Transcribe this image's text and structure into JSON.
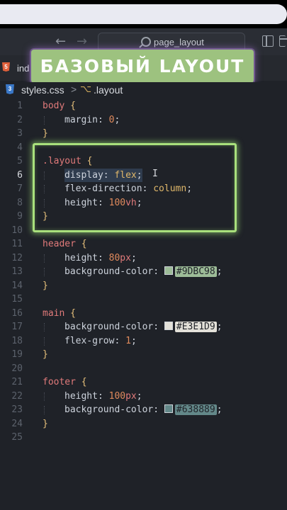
{
  "window": {
    "search_text": "page_layout",
    "back_icon": "arrow-left-icon",
    "forward_icon": "arrow-right-icon"
  },
  "tab": {
    "label": "ind"
  },
  "banner": {
    "text": "БАЗОВЫЙ LAYOUT"
  },
  "breadcrumb": {
    "file": "styles.css",
    "separator": ">",
    "symbol": ".layout"
  },
  "colors": {
    "header_bg": "#9DBC98",
    "main_bg": "#E3E1D9",
    "footer_bg": "#638889",
    "highlight_green": "#a9e07c"
  },
  "code_lines": [
    {
      "n": "1",
      "t": "body {"
    },
    {
      "n": "2",
      "p": "margin",
      "v": "0"
    },
    {
      "n": "3",
      "t": "}"
    },
    {
      "n": "4",
      "t": ""
    },
    {
      "n": "5",
      "t": ".layout {"
    },
    {
      "n": "6",
      "p": "display",
      "v": "flex"
    },
    {
      "n": "7",
      "p": "flex-direction",
      "v": "column"
    },
    {
      "n": "8",
      "p": "height",
      "v": "100vh"
    },
    {
      "n": "9",
      "t": "}"
    },
    {
      "n": "10",
      "t": ""
    },
    {
      "n": "11",
      "t": "header {"
    },
    {
      "n": "12",
      "p": "height",
      "v": "80px"
    },
    {
      "n": "13",
      "p": "background-color",
      "v": "#9DBC98"
    },
    {
      "n": "14",
      "t": "}"
    },
    {
      "n": "15",
      "t": ""
    },
    {
      "n": "16",
      "t": "main {"
    },
    {
      "n": "17",
      "p": "background-color",
      "v": "#E3E1D9"
    },
    {
      "n": "18",
      "p": "flex-grow",
      "v": "1"
    },
    {
      "n": "19",
      "t": "}"
    },
    {
      "n": "20",
      "t": ""
    },
    {
      "n": "21",
      "t": "footer {"
    },
    {
      "n": "22",
      "p": "height",
      "v": "100px"
    },
    {
      "n": "23",
      "p": "background-color",
      "v": "#638889"
    },
    {
      "n": "24",
      "t": "}"
    },
    {
      "n": "25",
      "t": ""
    }
  ],
  "current_line": "6"
}
